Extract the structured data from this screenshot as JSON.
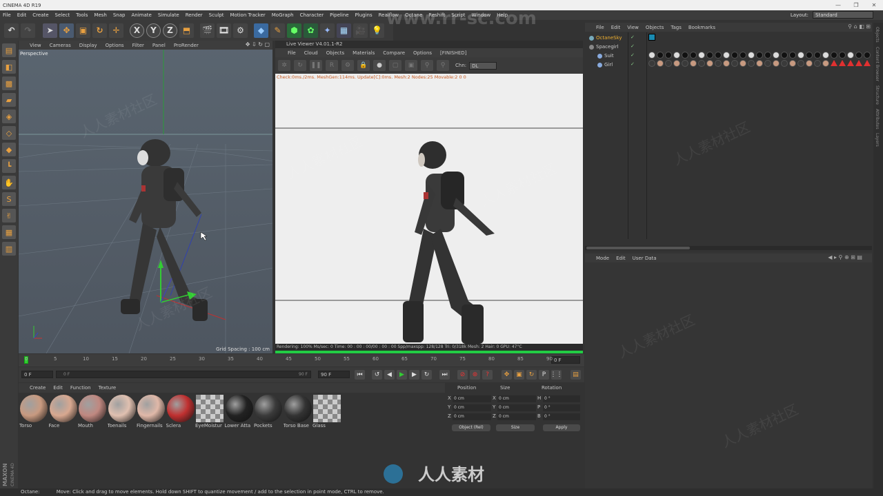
{
  "app": {
    "title": "CINEMA 4D R19",
    "window_buttons": [
      "—",
      "❐",
      "✕"
    ]
  },
  "menu": [
    "File",
    "Edit",
    "Create",
    "Select",
    "Tools",
    "Mesh",
    "Snap",
    "Animate",
    "Simulate",
    "Render",
    "Sculpt",
    "Motion Tracker",
    "MoGraph",
    "Character",
    "Pipeline",
    "Plugins",
    "Realflow",
    "Octane",
    "Reshift",
    "Script",
    "Window",
    "Help"
  ],
  "layout": {
    "label": "Layout:",
    "value": "Standard"
  },
  "toolbar_icons": [
    "undo-icon",
    "redo-icon",
    "select-icon",
    "move-icon",
    "scale-icon",
    "rotate-icon",
    "live-select-icon",
    "x-axis-icon",
    "y-axis-icon",
    "z-axis-icon",
    "coordinate-system-icon",
    "render-view-icon",
    "render-picture-viewer-icon",
    "edit-render-settings-icon",
    "cube-icon",
    "pen-icon",
    "subdivision-icon",
    "cloner-icon",
    "deformer-icon",
    "floor-icon",
    "camera-icon",
    "light-icon"
  ],
  "viewport": {
    "menu": [
      "View",
      "Cameras",
      "Display",
      "Options",
      "Filter",
      "Panel",
      "ProRender"
    ],
    "label": "Perspective",
    "grid_spacing": "Grid Spacing : 100 cm"
  },
  "live_viewer": {
    "title": "Live Viewer V4.01.1-R2",
    "menu": [
      "File",
      "Cloud",
      "Objects",
      "Materials",
      "Compare",
      "Options",
      "[FINISHED]"
    ],
    "channel_label": "Chn:",
    "channel_value": "DL",
    "check_text": "Check:0ms./2ms. MeshGen:114ms. Update[C]:0ms. Mesh:2 Nodes:25 Movable:2  0 0",
    "status": "Rendering: 100%  Ms/sec: 0    Time: 00 : 00 : 00/00 : 00 : 00   Spp/maxspp: 128/128    Tri: 0/318k   Mesh: 2   Hair: 0     GPU:     47°C",
    "progress": 1.0
  },
  "objects": {
    "menu": [
      "File",
      "Edit",
      "View",
      "Objects",
      "Tags",
      "Bookmarks"
    ],
    "items": [
      {
        "name": "OctaneSky",
        "color": "#f0b030"
      },
      {
        "name": "Spacegirl",
        "color": "#cccccc"
      },
      {
        "name": "Suit",
        "color": "#cccccc"
      },
      {
        "name": "Girl",
        "color": "#cccccc"
      }
    ]
  },
  "attributes": {
    "menu": [
      "Mode",
      "Edit",
      "User Data"
    ]
  },
  "right_tabs": [
    "Objects",
    "Content Browser",
    "Structure",
    "Attributes",
    "Layers"
  ],
  "timeline": {
    "ticks": [
      "0",
      "5",
      "10",
      "15",
      "20",
      "25",
      "30",
      "35",
      "40",
      "45",
      "50",
      "55",
      "60",
      "65",
      "70",
      "75",
      "80",
      "85",
      "90"
    ],
    "current_frame": "0 F",
    "start": "0 F",
    "range_start": "0 F",
    "range_end": "90 F",
    "end": "90 F"
  },
  "materials": {
    "menu": [
      "Create",
      "Edit",
      "Function",
      "Texture"
    ],
    "items": [
      {
        "label": "Torso",
        "color": "#c89a80"
      },
      {
        "label": "Face",
        "color": "#d8a890"
      },
      {
        "label": "Mouth",
        "color": "#c08880"
      },
      {
        "label": "Toenails",
        "color": "#e0c0b0"
      },
      {
        "label": "Fingernails",
        "color": "#e0b8a8"
      },
      {
        "label": "Sclera",
        "color": "#c03030"
      },
      {
        "label": "EyeMoistur",
        "color": "#dddddd"
      },
      {
        "label": "Lower Atta",
        "color": "#222222"
      },
      {
        "label": "Pockets",
        "color": "#3a3a3a"
      },
      {
        "label": "Torso Base",
        "color": "#333333"
      },
      {
        "label": "Glass",
        "color": "#dddddd"
      }
    ]
  },
  "coordinates": {
    "headers": [
      "Position",
      "Size",
      "Rotation"
    ],
    "rows": [
      {
        "axis": "X",
        "pos": "0 cm",
        "saxis": "X",
        "size": "0 cm",
        "raxis": "H",
        "rot": "0 °"
      },
      {
        "axis": "Y",
        "pos": "0 cm",
        "saxis": "Y",
        "size": "0 cm",
        "raxis": "P",
        "rot": "0 °"
      },
      {
        "axis": "Z",
        "pos": "0 cm",
        "saxis": "Z",
        "size": "0 cm",
        "raxis": "B",
        "rot": "0 °"
      }
    ],
    "mode": "Object (Rel)",
    "size_mode": "Size",
    "apply": "Apply"
  },
  "statusbar": {
    "left": "Octane:",
    "message": "Move: Click and drag to move elements. Hold down SHIFT to quantize movement / add to the selection in point mode, CTRL to remove."
  },
  "branding": {
    "watermark_url": "www.rr-sc.com",
    "maxon_logo": "MAXON CINEMA 4D",
    "center_logo": "人人素材"
  }
}
